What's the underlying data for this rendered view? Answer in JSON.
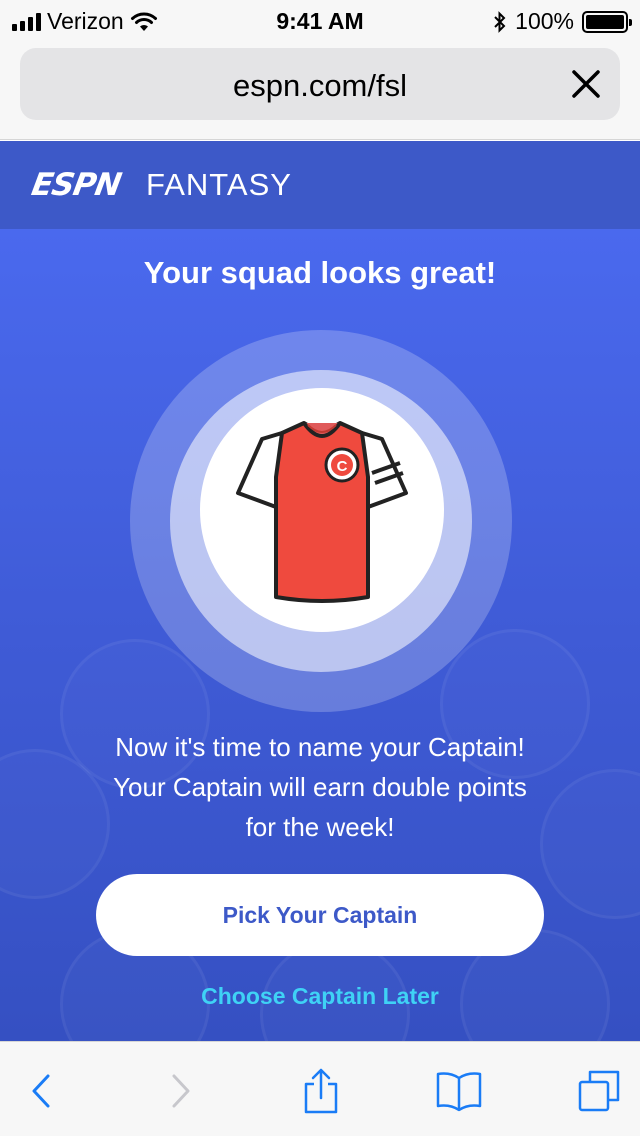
{
  "status_bar": {
    "carrier": "Verizon",
    "time": "9:41 AM",
    "battery": "100%",
    "battery_level": 1.0,
    "icons": [
      "signal-icon",
      "wifi-icon",
      "bluetooth-icon",
      "battery-icon"
    ]
  },
  "browser": {
    "url": "espn.com/fsl",
    "close_icon": "close-icon"
  },
  "header": {
    "logo": "ESPN",
    "title": "FANTASY"
  },
  "main": {
    "headline": "Your squad looks great!",
    "jersey_badge": "C",
    "message_lines": [
      "Now it's time to name your Captain!",
      "Your Captain will earn double points",
      "for the week!"
    ],
    "primary_button": "Pick Your Captain",
    "secondary_link": "Choose Captain Later"
  },
  "toolbar": {
    "icons": [
      "back-icon",
      "forward-icon",
      "share-icon",
      "bookmarks-icon",
      "tabs-icon"
    ]
  },
  "colors": {
    "brand_blue": "#3d59c8",
    "panel_top": "#4a69ee",
    "link_cyan": "#3fd2f5",
    "ios_blue": "#1a7cf6",
    "jersey_red": "#ef4a3e"
  }
}
